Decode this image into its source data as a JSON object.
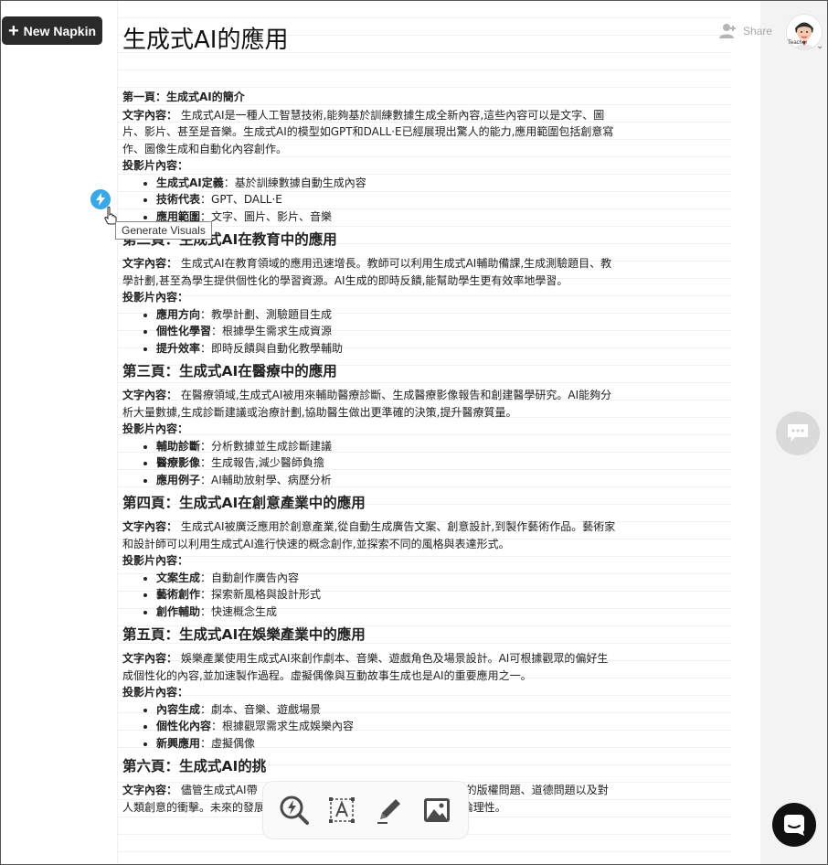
{
  "header": {
    "new_button_label": "New Napkin",
    "doc_title": "生成式AI的應用",
    "share_label": "Share",
    "avatar_label": "Teacher"
  },
  "tooltip": "Generate Visuals",
  "sections": [
    {
      "heading": "第一頁：生成式AI的簡介",
      "text_label": "文字內容：",
      "text": " 生成式AI是一種人工智慧技術,能夠基於訓練數據生成全新內容,這些內容可以是文字、圖片、影片、甚至是音樂。生成式AI的模型如GPT和DALL·E已經展現出驚人的能力,應用範圍包括創意寫作、圖像生成和自動化內容創作。",
      "slides_label": "投影片內容：",
      "bullets": [
        {
          "k": "生成式AI定義",
          "v": "：基於訓練數據自動生成內容"
        },
        {
          "k": "技術代表",
          "v": "：GPT、DALL·E"
        },
        {
          "k": "應用範圍",
          "v": "：文字、圖片、影片、音樂"
        }
      ]
    },
    {
      "heading": "第二頁：生成式AI在教育中的應用",
      "text_label": "文字內容：",
      "text": " 生成式AI在教育領域的應用迅速增長。教師可以利用生成式AI輔助備課,生成測驗題目、教學計劃,甚至為學生提供個性化的學習資源。AI生成的即時反饋,能幫助學生更有效率地學習。",
      "slides_label": "投影片內容：",
      "bullets": [
        {
          "k": "應用方向",
          "v": "：教學計劃、測驗題目生成"
        },
        {
          "k": "個性化學習",
          "v": "：根據學生需求生成資源"
        },
        {
          "k": "提升效率",
          "v": "：即時反饋與自動化教學輔助"
        }
      ]
    },
    {
      "heading": "第三頁：生成式AI在醫療中的應用",
      "text_label": "文字內容：",
      "text": " 在醫療領域,生成式AI被用來輔助醫療診斷、生成醫療影像報告和創建醫學研究。AI能夠分析大量數據,生成診斷建議或治療計劃,協助醫生做出更準確的決策,提升醫療質量。",
      "slides_label": "投影片內容：",
      "bullets": [
        {
          "k": "輔助診斷",
          "v": "：分析數據並生成診斷建議"
        },
        {
          "k": "醫療影像",
          "v": "：生成報告,減少醫師負擔"
        },
        {
          "k": "應用例子",
          "v": "：AI輔助放射學、病歷分析"
        }
      ]
    },
    {
      "heading": "第四頁：生成式AI在創意產業中的應用",
      "text_label": "文字內容：",
      "text": " 生成式AI被廣泛應用於創意產業,從自動生成廣告文案、創意設計,到製作藝術作品。藝術家和設計師可以利用生成式AI進行快速的概念創作,並探索不同的風格與表達形式。",
      "slides_label": "投影片內容：",
      "bullets": [
        {
          "k": "文案生成",
          "v": "：自動創作廣告內容"
        },
        {
          "k": "藝術創作",
          "v": "：探索新風格與設計形式"
        },
        {
          "k": "創作輔助",
          "v": "：快速概念生成"
        }
      ]
    },
    {
      "heading": "第五頁：生成式AI在娛樂產業中的應用",
      "text_label": "文字內容：",
      "text": " 娛樂產業使用生成式AI來創作劇本、音樂、遊戲角色及場景設計。AI可根據觀眾的偏好生成個性化的內容,並加速製作過程。虛擬偶像與互動故事生成也是AI的重要應用之一。",
      "slides_label": "投影片內容：",
      "bullets": [
        {
          "k": "內容生成",
          "v": "：劇本、音樂、遊戲場景"
        },
        {
          "k": "個性化內容",
          "v": "：根據觀眾需求生成娛樂內容"
        },
        {
          "k": "新興應用",
          "v": "：虛擬偶像"
        }
      ]
    },
    {
      "heading": "第六頁：生成式AI的挑",
      "text_label": "文字內容：",
      "text": " 儘管生成式AI帶　　　　　　　　　　　　　　如生成內容的版權問題、道德問題以及對人類創意的衝擊。未來的發展方向將專注於增強AI的安全性、透明度及倫理性。",
      "slides_label": "",
      "bullets": []
    }
  ],
  "toolbar": {
    "tools": [
      "generate-visuals-icon",
      "text-box-icon",
      "pen-icon",
      "image-icon"
    ]
  }
}
